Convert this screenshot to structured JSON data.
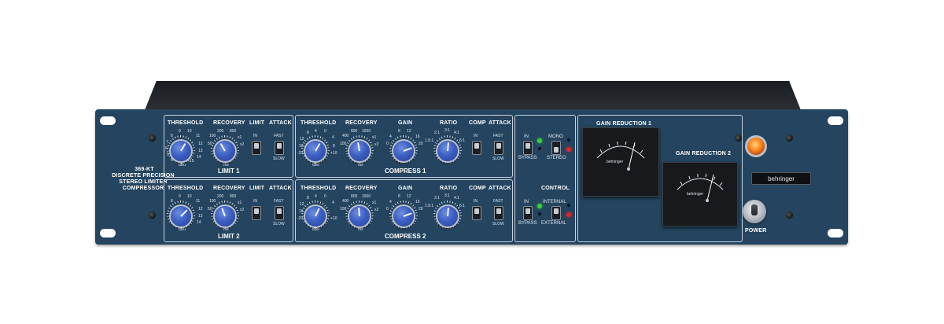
{
  "unit": {
    "model_title": "369-KT",
    "model_line2": "DISCRETE PRECISION",
    "model_line3": "STEREO LIMITER",
    "model_line4": "COMPRESSOR",
    "brand": "behringer",
    "power_label": "POWER"
  },
  "limit1": {
    "threshold": "THRESHOLD",
    "recovery": "RECOVERY",
    "limit": "LIMIT",
    "attack": "ATTACK",
    "in": "IN",
    "fast": "FAST",
    "slow": "SLOW",
    "title": "LIMIT 1",
    "thr_unit": "dBu",
    "rec_unit": "ms",
    "thr_ticks": [
      "9",
      "10",
      "8",
      "11",
      "7",
      "12",
      "6",
      "13",
      "5",
      "14",
      "4",
      "+15"
    ],
    "rec_ticks": [
      "200",
      "800",
      "100",
      "x1",
      "50",
      "x2"
    ]
  },
  "limit2": {
    "threshold": "THRESHOLD",
    "recovery": "RECOVERY",
    "limit": "LIMIT",
    "attack": "ATTACK",
    "in": "IN",
    "fast": "FAST",
    "slow": "SLOW",
    "title": "LIMIT 2",
    "thr_unit": "dBu",
    "rec_unit": "ms",
    "thr_ticks": [
      "9",
      "10",
      "8",
      "11",
      "12",
      "13",
      "14"
    ],
    "rec_ticks": [
      "200",
      "800",
      "100",
      "x1",
      "50",
      "x2"
    ]
  },
  "compress1": {
    "threshold": "THRESHOLD",
    "recovery": "RECOVERY",
    "gain": "GAIN",
    "ratio": "RATIO",
    "comp": "COMP",
    "attack": "ATTACK",
    "in": "IN",
    "fast": "FAST",
    "slow": "SLOW",
    "title": "COMPRESS 1",
    "thr_unit": "dBu",
    "rec_unit": "ms",
    "thr_ticks": [
      "8",
      "4",
      "0",
      "4",
      "12",
      "16",
      "-20",
      "8",
      "+10"
    ],
    "rec_ticks": [
      "800",
      "1500",
      "400",
      "x1",
      "100",
      "x2"
    ],
    "gain_ticks": [
      "8",
      "12",
      "4",
      "16",
      "0",
      "20"
    ],
    "ratio_ticks": [
      "3:1",
      "2:1",
      "4:1",
      "1.5:1",
      "6:1"
    ]
  },
  "compress2": {
    "threshold": "THRESHOLD",
    "recovery": "RECOVERY",
    "gain": "GAIN",
    "ratio": "RATIO",
    "comp": "COMP",
    "attack": "ATTACK",
    "in": "IN",
    "fast": "FAST",
    "slow": "SLOW",
    "title": "COMPRESS 2",
    "thr_unit": "dBu",
    "rec_unit": "ms",
    "thr_ticks": [
      "8",
      "4",
      "0",
      "4",
      "12",
      "16",
      "-20",
      "+10"
    ],
    "rec_ticks": [
      "800",
      "1500",
      "400",
      "x1",
      "100",
      "x2"
    ],
    "gain_ticks": [
      "8",
      "12",
      "4",
      "16",
      "0",
      "20"
    ],
    "ratio_ticks": [
      "3:1",
      "2:1",
      "4:1",
      "1.5:1",
      "6:1"
    ]
  },
  "routing": {
    "in1": "IN",
    "bypass1": "BYPASS",
    "mono": "MONO",
    "stereo": "STEREO",
    "control": "CONTROL",
    "in2": "IN",
    "bypass2": "BYPASS",
    "internal": "INTERNAL",
    "external": "EXTERNAL"
  },
  "meters": {
    "gr1": "GAIN REDUCTION 1",
    "gr2": "GAIN REDUCTION 2",
    "face_brand": "behringer"
  },
  "colors": {
    "panel": "#24445f",
    "panel_line": "#c9d3dc",
    "knob_blue": "#3c5fc2",
    "led_green": "#37d13c",
    "led_red": "#e3242b",
    "power_amber": "#ff8a1c"
  }
}
